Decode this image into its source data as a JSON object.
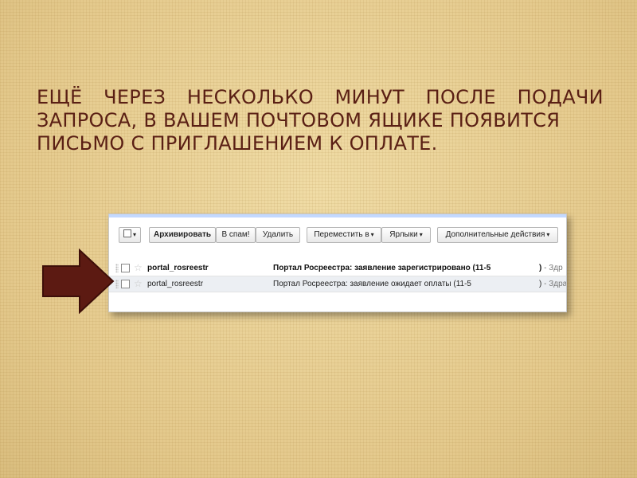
{
  "heading": {
    "line1_words": [
      "ЕЩЁ",
      "ЧЕРЕЗ",
      "НЕСКОЛЬКО",
      "МИНУТ",
      "ПОСЛЕ",
      "ПОДАЧИ"
    ],
    "line2": "ЗАПРОСА, В ВАШЕМ ПОЧТОВОМ ЯЩИКЕ ПОЯВИТСЯ",
    "line3": "ПИСЬМО С ПРИГЛАШЕНИЕМ К ОПЛАТЕ."
  },
  "toolbar": {
    "select_arrow": "▾",
    "archive": "Архивировать",
    "spam": "В спам!",
    "delete": "Удалить",
    "move": "Переместить в",
    "labels": "Ярлыки",
    "more": "Дополнительные действия",
    "dropdown_arrow": "▾"
  },
  "emails": [
    {
      "sender": "portal_rosreestr",
      "subject": "Портал Росреестра: заявление зарегистрировано (11-5",
      "suffix": ")",
      "snippet": " - Здр",
      "unread": true
    },
    {
      "sender": "portal_rosreestr",
      "subject": "Портал Росреестра: заявление ожидает оплаты (11-5",
      "suffix": ")",
      "snippet": " - Здравствуй",
      "unread": false
    }
  ],
  "colors": {
    "background": "#e9d39c",
    "heading_text": "#5a1f14",
    "arrow_fill": "#5c1a12"
  },
  "icons": {
    "pointer_arrow": "right-arrow-icon",
    "star": "star-icon"
  },
  "glyphs": {
    "star": "☆"
  }
}
